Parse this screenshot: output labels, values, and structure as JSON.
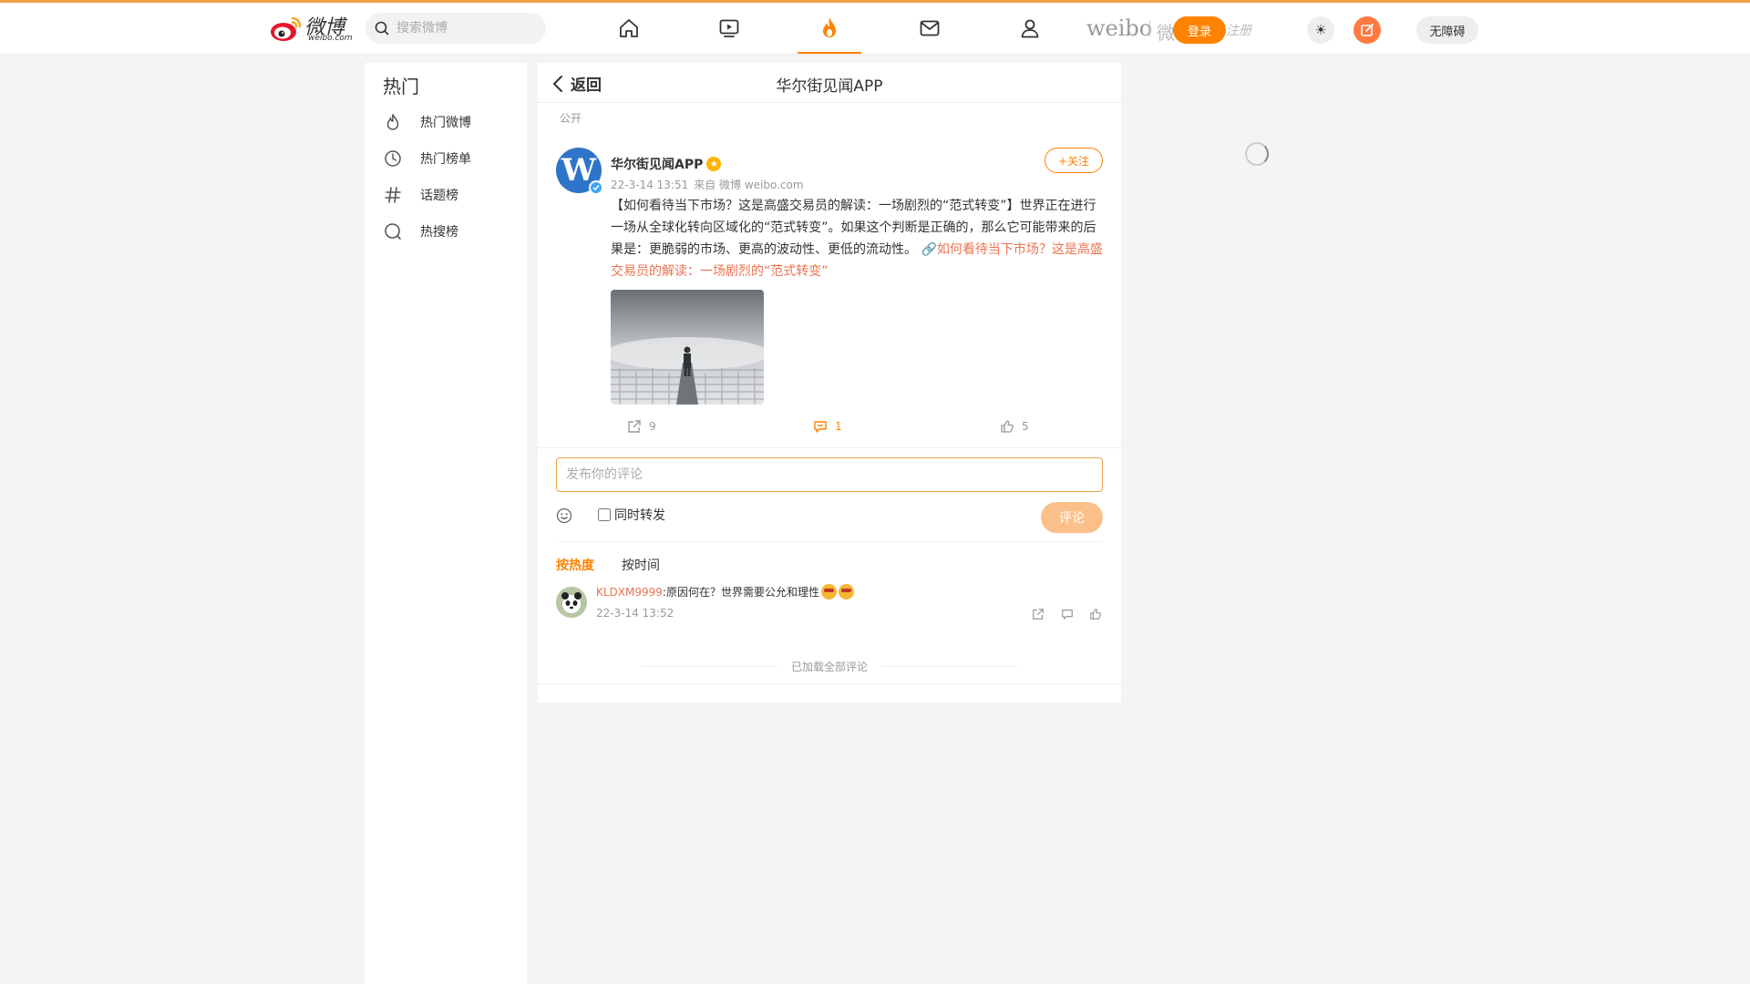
{
  "header": {
    "logo_text": "微博",
    "logo_sub": "weibo.com",
    "search_placeholder": "搜索微博",
    "nav": [
      {
        "name": "home",
        "icon": "home-icon",
        "active": false
      },
      {
        "name": "video",
        "icon": "video-icon",
        "active": false
      },
      {
        "name": "hot",
        "icon": "fire-icon",
        "active": true
      },
      {
        "name": "messages",
        "icon": "mail-icon",
        "active": false
      },
      {
        "name": "profile",
        "icon": "user-icon",
        "active": false
      }
    ],
    "brand_en": "weibo",
    "brand_cn": "微博",
    "login_label": "登录",
    "register_ghost": "注册",
    "theme_icon": "☀",
    "accessibility_label": "无障碍",
    "accent_color": "#ff8200"
  },
  "sidebar": {
    "title": "热门",
    "items": [
      {
        "label": "热门微博",
        "icon": "fire-outline-icon"
      },
      {
        "label": "热门榜单",
        "icon": "clock-icon"
      },
      {
        "label": "话题榜",
        "icon": "hashtag-icon"
      },
      {
        "label": "热搜榜",
        "icon": "search-circle-icon"
      }
    ]
  },
  "main": {
    "back_label": "返回",
    "page_title": "华尔街见闻APP",
    "visibility": "公开",
    "post": {
      "author": "华尔街见闻APP",
      "time": "22-3-14 13:51",
      "source": "来自 微博 weibo.com",
      "follow_label": "+关注",
      "text": "【如何看待当下市场？这是高盛交易员的解读：一场剧烈的“范式转变”】世界正在进行一场从全球化转向区域化的“范式转变”。如果这个判断是正确的，那么它可能带来的后果是：更脆弱的市场、更高的波动性、更低的流动性。",
      "link_text": "如何看待当下市场？这是高盛交易员的解读：一场剧烈的“范式转变”",
      "reposts": "9",
      "comments": "1",
      "likes": "5"
    },
    "comment_input_placeholder": "发布你的评论",
    "repost_also_label": "同时转发",
    "submit_label": "评论",
    "sort_hot": "按热度",
    "sort_time": "按时间",
    "comments_list": [
      {
        "user": "KLDXM9999",
        "text": ":原因何在？世界需要公允和理性",
        "time": "22-3-14 13:52"
      }
    ],
    "loaded_all": "已加载全部评论"
  }
}
